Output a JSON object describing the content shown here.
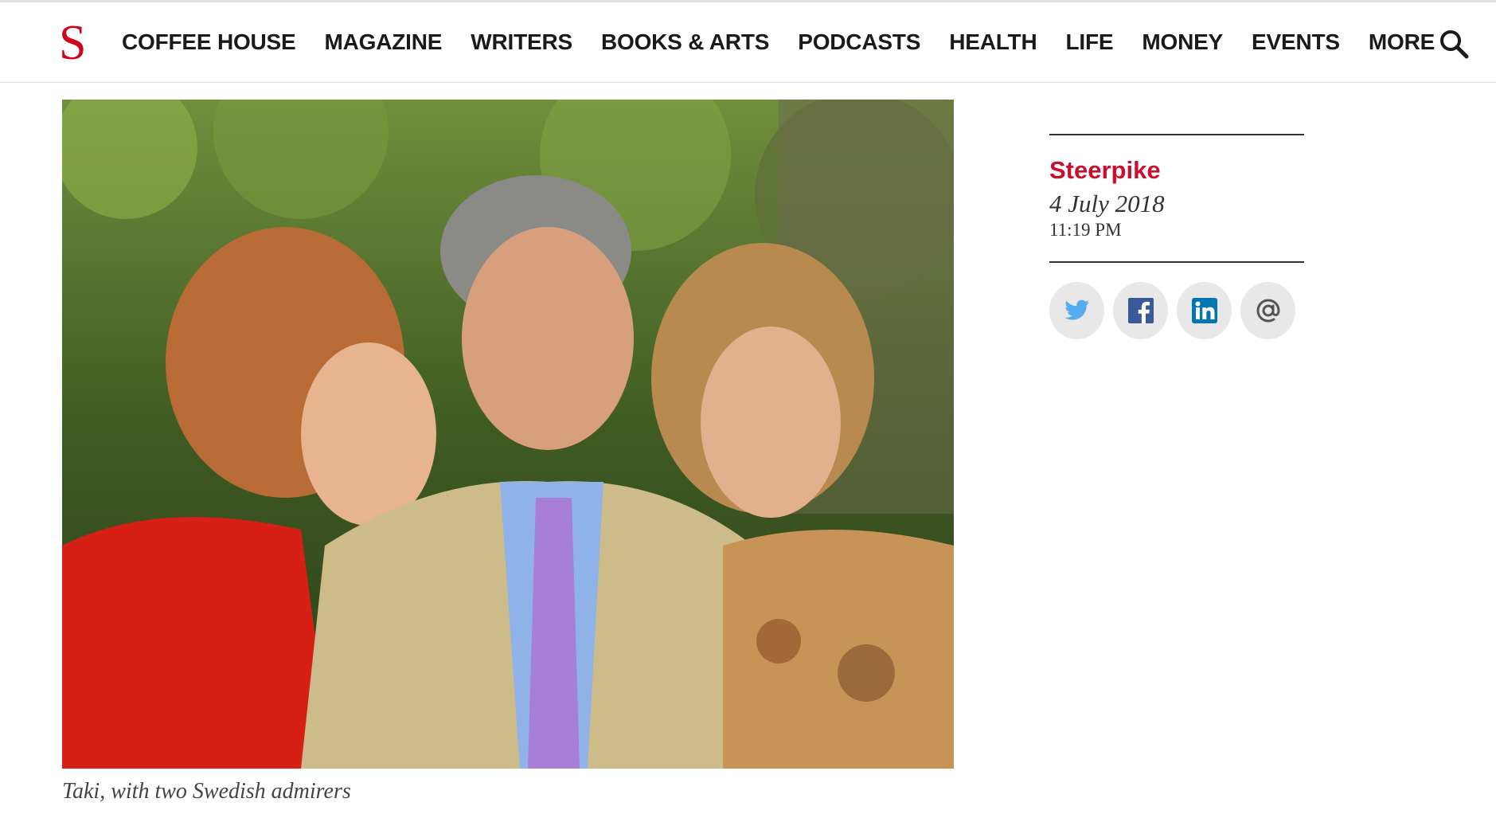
{
  "header": {
    "logo": "S",
    "nav": [
      "COFFEE HOUSE",
      "MAGAZINE",
      "WRITERS",
      "BOOKS & ARTS",
      "PODCASTS",
      "HEALTH",
      "LIFE",
      "MONEY",
      "EVENTS",
      "MORE"
    ],
    "search_icon": "search-icon"
  },
  "article": {
    "image_caption": "Taki, with two Swedish admirers",
    "author": "Steerpike",
    "date": "4 July 2018",
    "time": "11:19 PM"
  },
  "share": {
    "icons": [
      "twitter-icon",
      "facebook-icon",
      "linkedin-icon",
      "email-icon"
    ]
  },
  "colors": {
    "brand_red": "#d0021b",
    "author_red": "#c8102e",
    "twitter": "#55acee",
    "facebook": "#3b5998",
    "linkedin": "#0077b5"
  }
}
